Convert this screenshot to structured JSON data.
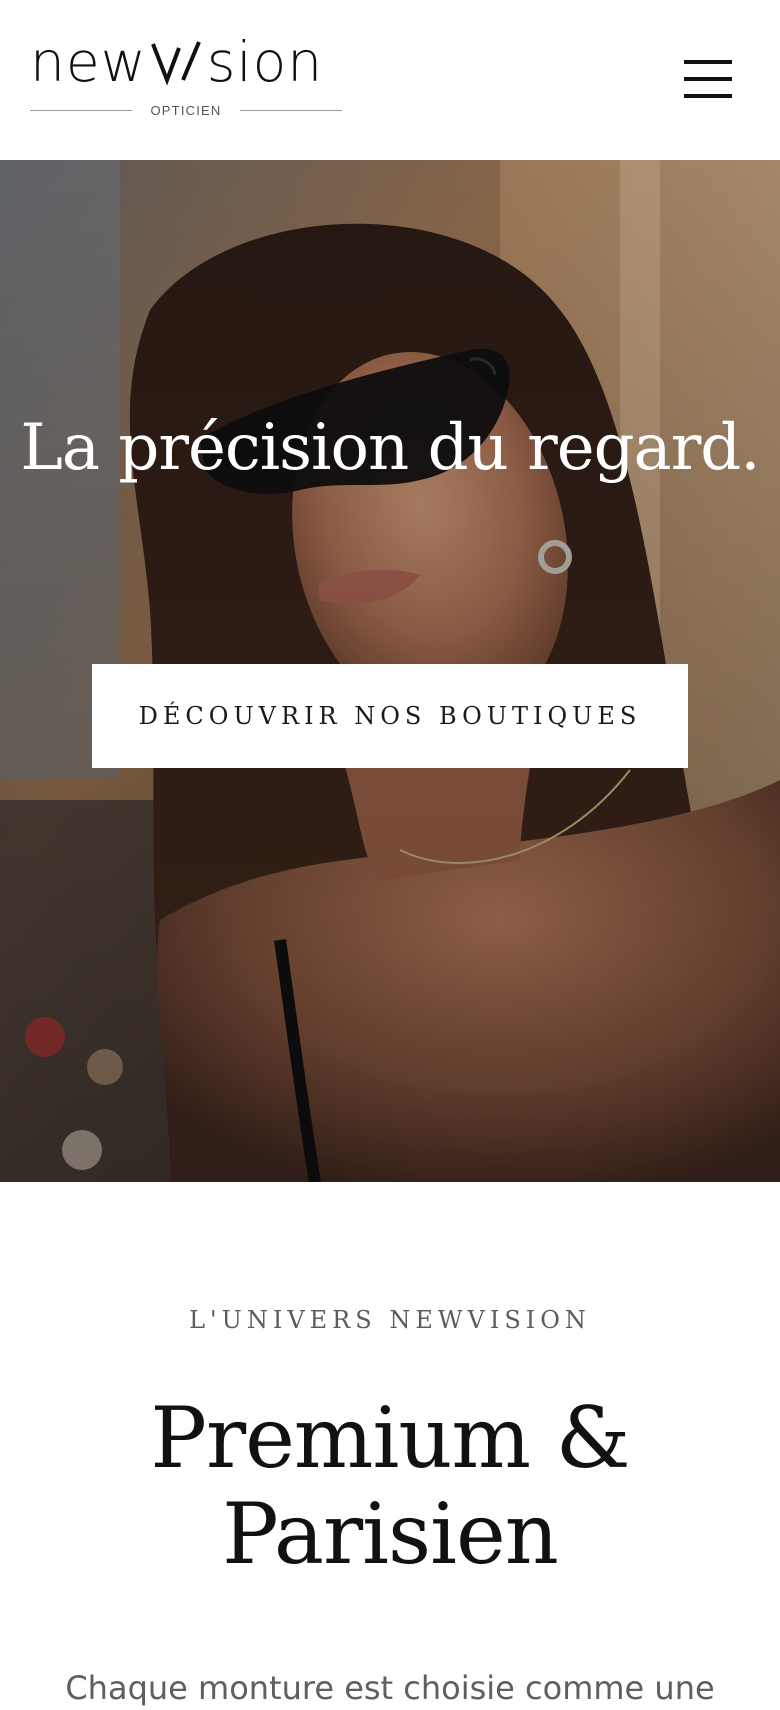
{
  "header": {
    "logo": {
      "wordmark_left": "new",
      "wordmark_right": "sion",
      "wordmark_mark": "v/",
      "subtitle": "OPTICIEN"
    },
    "menu_icon": "hamburger-menu-icon"
  },
  "hero": {
    "title": "La précision du regard.",
    "cta_label": "DÉCOUVRIR NOS BOUTIQUES",
    "photo_subject": "hero-photo"
  },
  "univers": {
    "eyebrow": "L'UNIVERS NEWVISION",
    "title_line1": "Premium &",
    "title_line2": "Parisien",
    "body": "Chaque monture est choisie comme une"
  },
  "colors": {
    "background": "#ffffff",
    "text_dark": "#111111",
    "text_muted": "#5f5f5f",
    "cta_background": "#ffffff",
    "hero_overlay": "#2a1f19"
  }
}
